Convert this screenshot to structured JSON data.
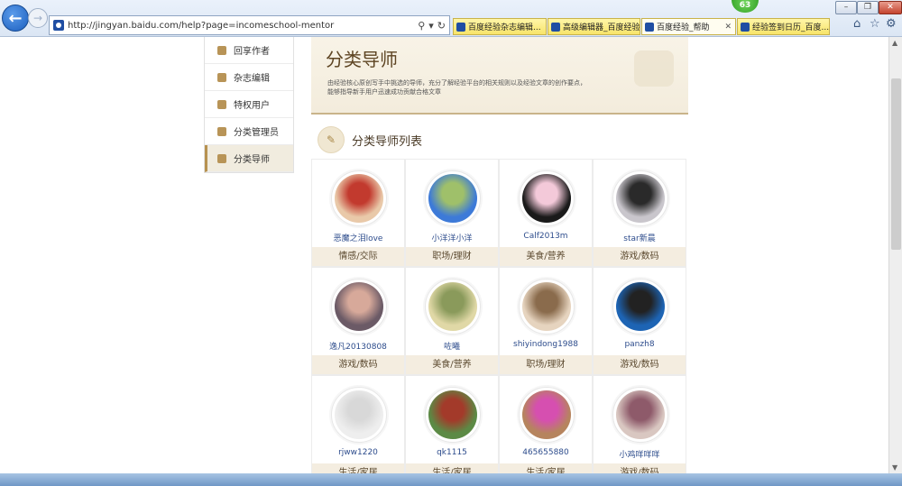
{
  "browser": {
    "url": "http://jingyan.baidu.com/help?page=incomeschool-mentor",
    "tabs": [
      {
        "label": "百度经验杂志编辑...",
        "active": false
      },
      {
        "label": "高级编辑器_百度经验",
        "active": false
      },
      {
        "label": "百度经验_帮助",
        "active": true
      },
      {
        "label": "经验签到日历_百度...",
        "active": false
      }
    ],
    "badge": "63",
    "window_buttons": [
      "–",
      "❐",
      "✕"
    ],
    "close_tab_glyph": "✕"
  },
  "sidebar": {
    "items": [
      {
        "label": "回享作者",
        "active": false
      },
      {
        "label": "杂志编辑",
        "active": false
      },
      {
        "label": "特权用户",
        "active": false
      },
      {
        "label": "分类管理员",
        "active": false
      },
      {
        "label": "分类导师",
        "active": true
      }
    ]
  },
  "banner": {
    "title": "分类导师",
    "desc_line1": "由经验核心原创写手中挑选的导师，充分了解经验平台的相关规则以及经验文章的创作要点，",
    "desc_line2": "能够指导新手用户迅速成功贡献合格文章"
  },
  "section": {
    "title": "分类导师列表"
  },
  "mentors": [
    {
      "name": "恶魔之泪love",
      "category": "情感/交际",
      "avatar_colors": [
        "#e9c9a9",
        "#c23a2e"
      ]
    },
    {
      "name": "小洋洋小洋",
      "category": "职场/理财",
      "avatar_colors": [
        "#3d7ad8",
        "#9fc06a"
      ]
    },
    {
      "name": "Calf2013m",
      "category": "美食/营养",
      "avatar_colors": [
        "#1a1a1a",
        "#f3c9d9"
      ]
    },
    {
      "name": "star新晨",
      "category": "游戏/数码",
      "avatar_colors": [
        "#c9c6cc",
        "#2a2a2a"
      ]
    },
    {
      "name": "逸凡20130808",
      "category": "游戏/数码",
      "avatar_colors": [
        "#6b5a66",
        "#d7a99a"
      ]
    },
    {
      "name": "咗曦",
      "category": "美食/营养",
      "avatar_colors": [
        "#e0d8a6",
        "#8a9a5b"
      ]
    },
    {
      "name": "shiyindong1988",
      "category": "职场/理财",
      "avatar_colors": [
        "#e6d4bf",
        "#8a6b4c"
      ]
    },
    {
      "name": "panzh8",
      "category": "游戏/数码",
      "avatar_colors": [
        "#1d64b4",
        "#222222"
      ]
    },
    {
      "name": "rjww1220",
      "category": "生活/家居",
      "avatar_colors": [
        "#eeeeee",
        "#d8d8d8"
      ]
    },
    {
      "name": "qk1115",
      "category": "生活/家居",
      "avatar_colors": [
        "#5c8a45",
        "#a33a2a"
      ]
    },
    {
      "name": "465655880",
      "category": "生活/家居",
      "avatar_colors": [
        "#b6845e",
        "#d64fb0"
      ]
    },
    {
      "name": "小鸡咩咩咩",
      "category": "游戏/数码",
      "avatar_colors": [
        "#d9c7c1",
        "#8e5a6a"
      ]
    }
  ]
}
